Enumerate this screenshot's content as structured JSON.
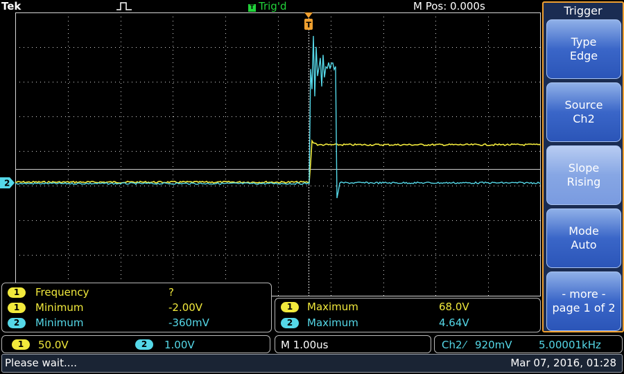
{
  "header": {
    "brand": "Tek",
    "trigger_status": "Trig'd",
    "trigger_icon": "T",
    "position": "M Pos: 0.000s",
    "acquisition_icon": "pulse-icon"
  },
  "colors": {
    "ch1": "#f2ea3c",
    "ch2": "#55d8e8",
    "trig_status": "#22d33a",
    "menu_border": "#f0a030",
    "graticule": "#d8d8d8"
  },
  "markers": {
    "ch2_ground": "2",
    "trigger_position": "T"
  },
  "menu": {
    "title": "Trigger",
    "buttons": [
      {
        "line1": "Type",
        "line2": "Edge"
      },
      {
        "line1": "Source",
        "line2": "Ch2"
      },
      {
        "line1": "Slope",
        "line2": "Rising"
      },
      {
        "line1": "Mode",
        "line2": "Auto"
      },
      {
        "line1": "- more -",
        "line2": "page 1 of 2"
      }
    ]
  },
  "measurements_left": [
    {
      "channel": "1",
      "label": "Frequency",
      "value": "?"
    },
    {
      "channel": "1",
      "label": "Minimum",
      "value": "-2.00V"
    },
    {
      "channel": "2",
      "label": "Minimum",
      "value": "-360mV"
    }
  ],
  "measurements_right": [
    {
      "channel": "1",
      "label": "Maximum",
      "value": "68.0V"
    },
    {
      "channel": "2",
      "label": "Maximum",
      "value": "4.64V"
    }
  ],
  "status": {
    "ch1_badge": "1",
    "ch1_scale": "50.0V",
    "ch2_badge": "2",
    "ch2_scale": "1.00V",
    "timebase": "M 1.00us",
    "trigger_source": "Ch2",
    "trigger_slope_symbol": "⁄",
    "trigger_level": "920mV",
    "trigger_frequency": "5.00001kHz"
  },
  "footer": {
    "message": "Please wait....",
    "datetime": "Mar 07, 2016, 01:28"
  }
}
